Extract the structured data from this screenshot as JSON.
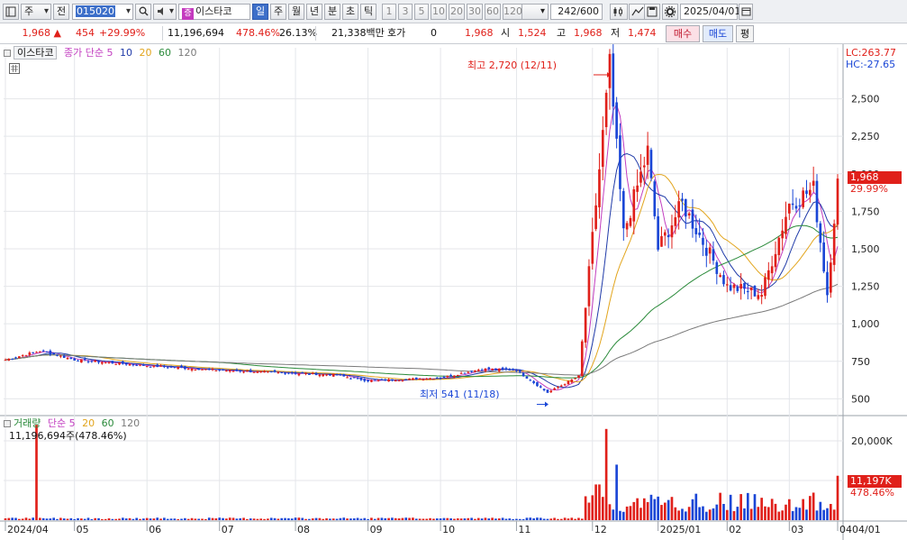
{
  "toolbar": {
    "market": "주",
    "prev_label": "전",
    "code": "015020",
    "name": "이스타코",
    "name_badge": "증",
    "periods": [
      "일",
      "주",
      "월",
      "년",
      "분",
      "초",
      "틱"
    ],
    "active_period": "일",
    "intervals": [
      "1",
      "3",
      "5",
      "10",
      "20",
      "30",
      "60",
      "120"
    ],
    "count": "242",
    "count_total": "/600",
    "date": "2025/04/01"
  },
  "quote": {
    "price": "1,968",
    "change": "454",
    "change_pct": "+29.99%",
    "volume": "11,196,694",
    "volume_pct": "478.46%",
    "turnover": "26.13%",
    "amount": "21,338백만",
    "hoga_label": "호가",
    "hoga_value": "0",
    "hoga_price": "1,968",
    "open_label": "시",
    "open": "1,524",
    "high_label": "고",
    "high": "1,968",
    "low_label": "저",
    "low": "1,474",
    "buy_label": "매수",
    "sell_label": "매도",
    "eval_label": "평"
  },
  "legend": {
    "title_tab": "이스타코",
    "main": "종가 단순",
    "ma": [
      "5",
      "10",
      "20",
      "60",
      "120"
    ],
    "volume_title": "거래량",
    "volume_ma_label": "단순",
    "volume_value": "11,196,694주(478.46%)"
  },
  "colors": {
    "up": "#e0201a",
    "down": "#1a46d6",
    "ma5": "#c23ec0",
    "ma10": "#1f3aa8",
    "ma20": "#e2a51d",
    "ma60": "#2a8a3a",
    "ma120": "#7a7a7a",
    "tag_bg": "#e0201a"
  },
  "annotations": {
    "high": "최고 2,720 (12/11)",
    "low": "최저 541 (11/18)",
    "lc": "LC:263.77",
    "hc": "HC:-27.65",
    "price_tag": "1,968",
    "price_pct": "29.99%",
    "vol_tag": "11,197K",
    "vol_pct": "478.46%"
  },
  "chart_data": {
    "type": "candlestick",
    "price_axis": {
      "ticks": [
        500,
        750,
        1000,
        1250,
        1500,
        1750,
        2000,
        2250,
        2500
      ],
      "labels": [
        "500",
        "750",
        "1,000",
        "1,250",
        "1,500",
        "1,750",
        "2,000",
        "2,250",
        "2,500"
      ]
    },
    "volume_axis": {
      "ticks": [
        10000000,
        20000000
      ],
      "labels": [
        "10,000K",
        "20,000K"
      ]
    },
    "x_labels": [
      "2024/04",
      "05",
      "06",
      "07",
      "08",
      "09",
      "10",
      "11",
      "12",
      "2025/01",
      "02",
      "03",
      "04"
    ],
    "right_x_label": "04/01",
    "anchors": [
      {
        "date": "2024/04",
        "close": 760
      },
      {
        "date": "04 mid",
        "close": 820
      },
      {
        "date": "05",
        "close": 760
      },
      {
        "date": "06",
        "close": 720
      },
      {
        "date": "07",
        "close": 690
      },
      {
        "date": "08",
        "close": 670
      },
      {
        "date": "08 mid",
        "close": 660
      },
      {
        "date": "09",
        "close": 620
      },
      {
        "date": "10",
        "close": 640
      },
      {
        "date": "10 mid",
        "close": 700
      },
      {
        "date": "11",
        "close": 690
      },
      {
        "date": "11/18",
        "close": 541
      },
      {
        "date": "12 start",
        "close": 650
      },
      {
        "date": "12/11",
        "close": 2720
      },
      {
        "date": "12 mid",
        "close": 1600
      },
      {
        "date": "12 late",
        "close": 2150
      },
      {
        "date": "2025/01",
        "close": 1500
      },
      {
        "date": "01 mid",
        "close": 1800
      },
      {
        "date": "02",
        "close": 1250
      },
      {
        "date": "02 mid",
        "close": 1200
      },
      {
        "date": "03",
        "close": 1800
      },
      {
        "date": "03 mid",
        "close": 1900
      },
      {
        "date": "03 late",
        "close": 1200
      },
      {
        "date": "04/01",
        "close": 1968
      }
    ]
  }
}
